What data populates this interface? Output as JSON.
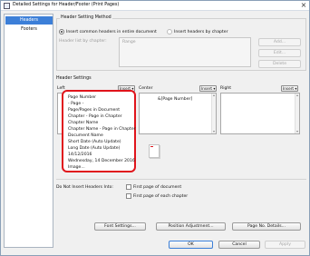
{
  "window": {
    "title": "Detailed Settings for Header/Footer (Print Pages)"
  },
  "nav": {
    "items": [
      {
        "label": "Headers",
        "selected": true
      },
      {
        "label": "Footers",
        "selected": false
      }
    ]
  },
  "method": {
    "group_label": "Header Setting Method",
    "option_common": "Insert common headers in entire document",
    "option_by_chapter": "Insert headers by chapter",
    "list_label": "Header list by chapter:",
    "list_header": "Range",
    "add_label": "Add...",
    "edit_label": "Edit...",
    "delete_label": "Delete"
  },
  "settings": {
    "group_label": "Header Settings",
    "left_label": "Left",
    "center_label": "Center",
    "right_label": "Right",
    "insert_label": "Insert ▾",
    "center_value": "&[Page Number]"
  },
  "insert_menu": {
    "items": [
      "Page Number",
      "- Page -",
      "Page/Pages in Document",
      "Chapter - Page in Chapter",
      "Chapter Name",
      "Chapter Name - Page in Chapter",
      "Document Name",
      "Short Date (Auto Update)",
      "Long Date (Auto Update)",
      "14/12/2016",
      "Wednesday, 14 December 2016",
      "Image..."
    ]
  },
  "not_insert": {
    "label": "Do Not Insert Headers Into:",
    "first_doc": "First page of document",
    "first_chapter": "First page of each chapter"
  },
  "buttons": {
    "font": "Font Settings...",
    "position": "Position Adjustment...",
    "page_no": "Page No. Details...",
    "ok": "OK",
    "cancel": "Cancel",
    "apply": "Apply"
  },
  "colors": {
    "selection": "#3c7fd8",
    "highlight": "#e0141b"
  }
}
